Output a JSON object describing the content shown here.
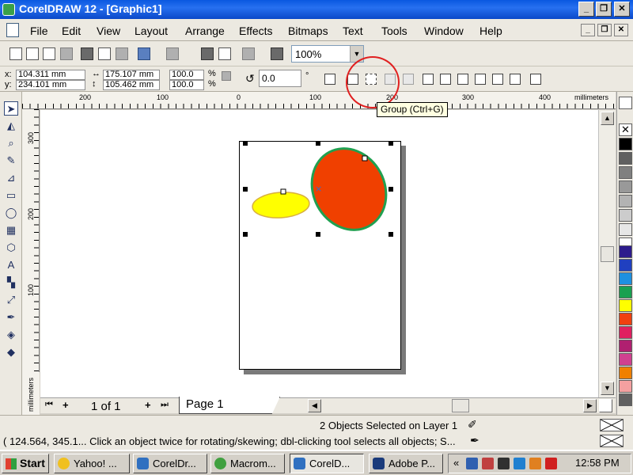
{
  "window": {
    "title": "CorelDRAW 12 - [Graphic1]",
    "minimize": "_",
    "restore": "❐",
    "close": "✕"
  },
  "menu": [
    "File",
    "Edit",
    "View",
    "Layout",
    "Arrange",
    "Effects",
    "Bitmaps",
    "Text",
    "Tools",
    "Window",
    "Help"
  ],
  "toolbar": {
    "zoom": "100%"
  },
  "propbar": {
    "x": "104.311 mm",
    "y": "234.101 mm",
    "width": "175.107 mm",
    "height": "105.462 mm",
    "scale_x": "100.0",
    "scale_y": "100.0",
    "percent": "%",
    "rotation": "0.0",
    "degree": "°",
    "x_label": "x:",
    "y_label": "y:"
  },
  "tooltip": "Group (Ctrl+G)",
  "ruler": {
    "units": "millimeters",
    "h_ticks": [
      "200",
      "100",
      "0",
      "100",
      "200",
      "300",
      "400"
    ],
    "v_ticks": [
      "300",
      "200",
      "100"
    ]
  },
  "shapes": {
    "yellow": {
      "fill": "#ffff00",
      "outline": "#d8b040"
    },
    "red": {
      "fill": "#f04000",
      "outline": "#20a050"
    }
  },
  "palette": [
    "#ffffff",
    "#000000",
    "#606060",
    "#808080",
    "#999999",
    "#b3b3b3",
    "#cccccc",
    "#e6e6e6",
    "#ffffff",
    "#2d1c8c",
    "#2040c0",
    "#1e90e0",
    "#18a050",
    "#ffff00",
    "#f04010",
    "#e02060",
    "#b02070",
    "#d04090",
    "#f08000",
    "#f4a0a0",
    "#c0c0c0",
    "#606060"
  ],
  "pagenav": {
    "counter": "1 of 1",
    "tab": "Page 1"
  },
  "status": {
    "selection": "2 Objects Selected on Layer 1",
    "hint": "( 124.564, 345.1...  Click an object twice for rotating/skewing; dbl-clicking tool selects all objects; S..."
  },
  "taskbar": {
    "start": "Start",
    "tasks": [
      "Yahoo! ...",
      "CorelDr...",
      "Macrom...",
      "CorelD...",
      "Adobe P..."
    ],
    "chevron": "«",
    "clock": "12:58 PM"
  }
}
